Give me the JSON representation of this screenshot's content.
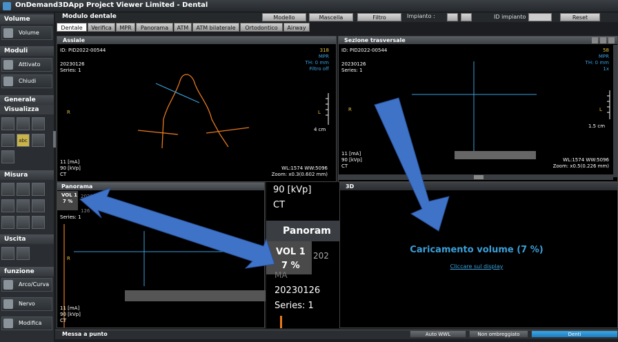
{
  "window": {
    "title": "OnDemand3DApp Project Viewer Limited - Dental"
  },
  "sidebar": {
    "sections": {
      "volume": "Volume",
      "moduli": "Moduli",
      "generale": "Generale",
      "visualizza": "Visualizza",
      "misura": "Misura",
      "uscita": "Uscita",
      "funzione": "funzione"
    },
    "buttons": {
      "volume": "Volume",
      "attivato": "Attivato",
      "chiudi": "Chiudi",
      "arco_curva": "Arco/Curva",
      "nervo": "Nervo",
      "modifica": "Modifica"
    },
    "abc_tool": "abc"
  },
  "header": {
    "module_title": "Modulo dentale",
    "buttons": [
      "Modello",
      "Mascella",
      "Filtro"
    ],
    "impianto_label": "Impianto :",
    "id_impianto_label": "ID impianto",
    "reset_label": "Reset"
  },
  "tabs": [
    "Dentale",
    "Verifica",
    "MPR",
    "Panorama",
    "ATM",
    "ATM bilaterale",
    "Ortodontico",
    "Airway"
  ],
  "viewports": {
    "assiale": {
      "title": "Assiale",
      "id": "ID: PID2022-00544",
      "date": "20230126",
      "series": "Series: 1",
      "slice": "318",
      "mode": "MPR",
      "th": "TH: 0 mm",
      "filter": "Filtro off",
      "r_marker": "R",
      "l_marker": "L",
      "scale": "4 cm",
      "ma": "11 [mA]",
      "kvp": "90 [kVp]",
      "ct": "CT",
      "wl": "WL:1574 WW:5096",
      "zoom": "Zoom: x0.3(0.602 mm)"
    },
    "sezione": {
      "title": "Sezione trasversale",
      "id": "ID: PID2022-00544",
      "date": "20230126",
      "series": "Series: 1",
      "slice": "58",
      "mode": "MPR",
      "th": "TH: 0 mm",
      "x": "1x",
      "r_marker": "R",
      "l_marker": "L",
      "scale": "1.5 cm",
      "ma": "11 [mA]",
      "kvp": "90 [kVp]",
      "ct": "CT",
      "wl": "WL:1574 WW:5096",
      "zoom": "Zoom: x0.5(0.226 mm)"
    },
    "panorama": {
      "title": "Panorama",
      "vol": "VOL 1",
      "pct": "7 %",
      "date_partial": "2023",
      "series_partial": "126",
      "series": "Series: 1",
      "r_marker": "R",
      "ma": "11 [mA]",
      "kvp": "90 [kVp]",
      "ct": "CT"
    },
    "threed": {
      "title": "3D",
      "loading": "Caricamento volume (7 %)",
      "link": "Cliccare sul display"
    }
  },
  "zoom_inset": {
    "kvp": "90 [kVp]",
    "ct": "CT",
    "title": "Panoram",
    "vol": "VOL 1",
    "pct": "7 %",
    "line1": "202",
    "line2": "MA",
    "date": "20230126",
    "series": "Series: 1"
  },
  "bottom": {
    "messa": "Messa a punto",
    "auto_wwl": "Auto WWL",
    "non_ombreggiato": "Non ombreggiato",
    "denti": "Denti"
  },
  "colors": {
    "accent_blue": "#3a9fd8",
    "arrow_blue": "#3f73c8",
    "orange": "#e87a1e"
  }
}
